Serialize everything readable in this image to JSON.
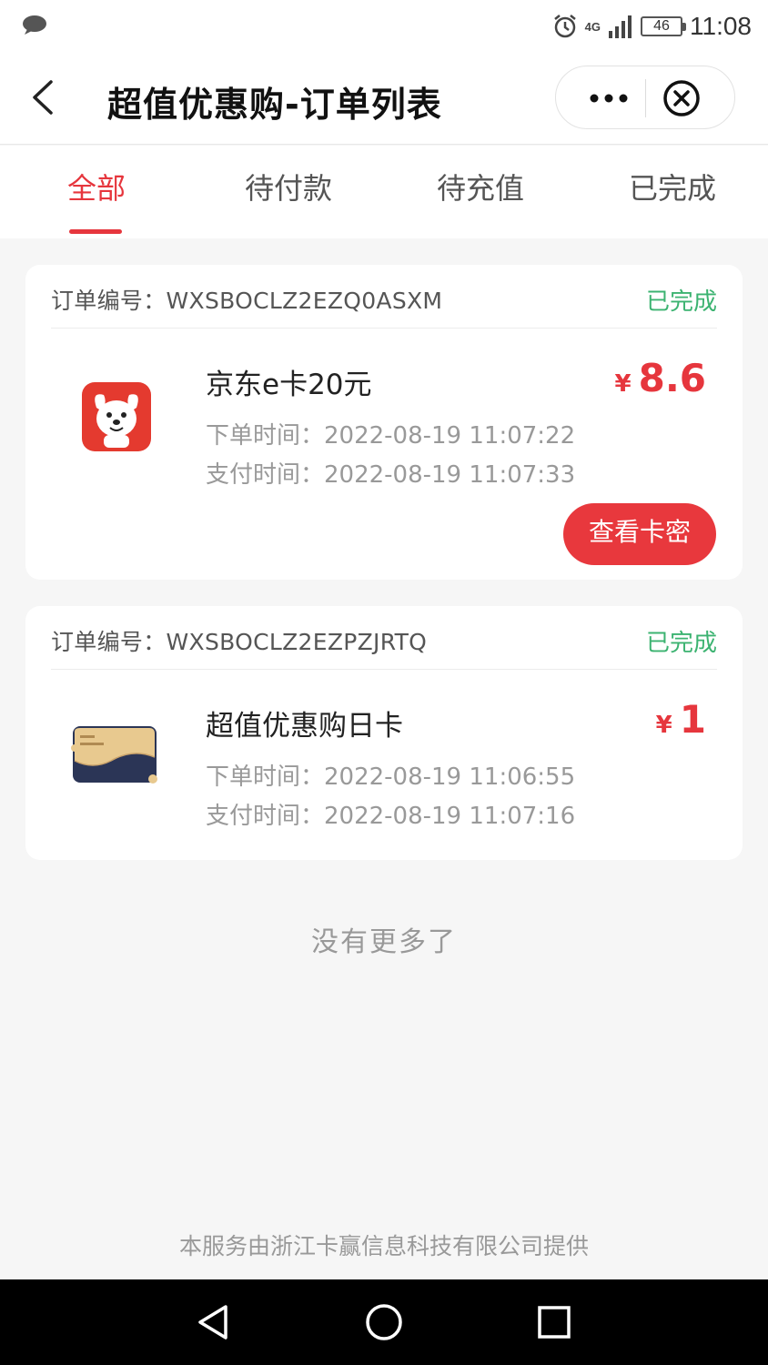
{
  "status_bar": {
    "time": "11:08",
    "battery": "46",
    "network": "4G",
    "icons": [
      "chat-bubble-icon",
      "alarm-icon",
      "signal-icon",
      "battery-icon"
    ]
  },
  "nav": {
    "title": "超值优惠购-订单列表",
    "icons": [
      "back-chevron-icon",
      "more-dots-icon",
      "close-circle-icon"
    ]
  },
  "tabs": [
    {
      "label": "全部",
      "active": true
    },
    {
      "label": "待付款",
      "active": false
    },
    {
      "label": "待充值",
      "active": false
    },
    {
      "label": "已完成",
      "active": false
    }
  ],
  "orders": [
    {
      "order_no": "订单编号：WXSBOCLZ2EZQ0ASXM",
      "status": "已完成",
      "product": "京东e卡20元",
      "currency": "¥",
      "price": "8.6",
      "order_time": "下单时间：2022-08-19 11:07:22",
      "pay_time": "支付时间：2022-08-19 11:07:33",
      "action": "查看卡密",
      "icon": "jd-dog-icon"
    },
    {
      "order_no": "订单编号：WXSBOCLZ2EZPZJRTQ",
      "status": "已完成",
      "product": "超值优惠购日卡",
      "currency": "¥",
      "price": "1",
      "order_time": "下单时间：2022-08-19 11:06:55",
      "pay_time": "支付时间：2022-08-19 11:07:16",
      "icon": "member-card-icon"
    }
  ],
  "no_more": "没有更多了",
  "footer": "本服务由浙江卡赢信息科技有限公司提供",
  "colors": {
    "accent": "#e6363d",
    "success": "#3cb371",
    "muted": "#999999"
  },
  "android_nav": {
    "icons": [
      "back-triangle-icon",
      "home-circle-icon",
      "recents-square-icon"
    ]
  }
}
